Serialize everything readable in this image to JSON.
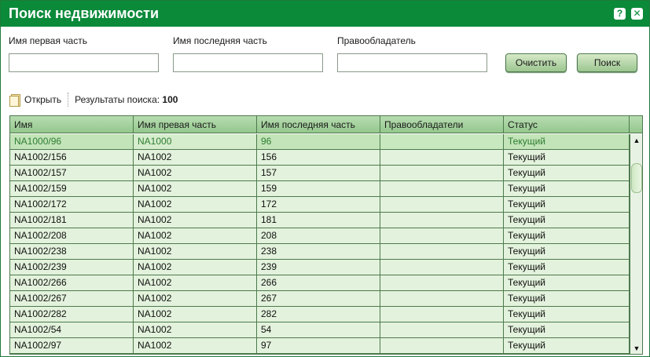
{
  "window": {
    "title": "Поиск недвижимости",
    "help_icon": "?",
    "close_icon": "✕"
  },
  "form": {
    "first_part_label": "Имя первая часть",
    "first_part_value": "",
    "last_part_label": "Имя последняя часть",
    "last_part_value": "",
    "owner_label": "Правообладатель",
    "owner_value": "",
    "clear_button": "Очистить",
    "search_button": "Поиск"
  },
  "toolbar": {
    "open_label": "Открыть",
    "results_label": "Результаты поиска:",
    "results_count": "100"
  },
  "grid": {
    "columns": [
      "Имя",
      "Имя превая часть",
      "Имя последняя часть",
      "Правообладатели",
      "Статус"
    ],
    "rows": [
      {
        "name": "NA1000/96",
        "first": "NA1000",
        "last": "96",
        "owners": "",
        "status": "Текущий"
      },
      {
        "name": "NA1002/156",
        "first": "NA1002",
        "last": "156",
        "owners": "",
        "status": "Текущий"
      },
      {
        "name": "NA1002/157",
        "first": "NA1002",
        "last": "157",
        "owners": "",
        "status": "Текущий"
      },
      {
        "name": "NA1002/159",
        "first": "NA1002",
        "last": "159",
        "owners": "",
        "status": "Текущий"
      },
      {
        "name": "NA1002/172",
        "first": "NA1002",
        "last": "172",
        "owners": "",
        "status": "Текущий"
      },
      {
        "name": "NA1002/181",
        "first": "NA1002",
        "last": "181",
        "owners": "",
        "status": "Текущий"
      },
      {
        "name": "NA1002/208",
        "first": "NA1002",
        "last": "208",
        "owners": "",
        "status": "Текущий"
      },
      {
        "name": "NA1002/238",
        "first": "NA1002",
        "last": "238",
        "owners": "",
        "status": "Текущий"
      },
      {
        "name": "NA1002/239",
        "first": "NA1002",
        "last": "239",
        "owners": "",
        "status": "Текущий"
      },
      {
        "name": "NA1002/266",
        "first": "NA1002",
        "last": "266",
        "owners": "",
        "status": "Текущий"
      },
      {
        "name": "NA1002/267",
        "first": "NA1002",
        "last": "267",
        "owners": "",
        "status": "Текущий"
      },
      {
        "name": "NA1002/282",
        "first": "NA1002",
        "last": "282",
        "owners": "",
        "status": "Текущий"
      },
      {
        "name": "NA1002/54",
        "first": "NA1002",
        "last": "54",
        "owners": "",
        "status": "Текущий"
      },
      {
        "name": "NA1002/97",
        "first": "NA1002",
        "last": "97",
        "owners": "",
        "status": "Текущий"
      }
    ],
    "scroll_up_icon": "▲",
    "scroll_down_icon": "▼"
  },
  "colors": {
    "title_bar": "#0b8a3a",
    "header_bg": "#b7dcb0",
    "row_bg": "#e3f2dc",
    "selected_row_bg": "#c2e4b8",
    "selected_text": "#2e7d32"
  }
}
